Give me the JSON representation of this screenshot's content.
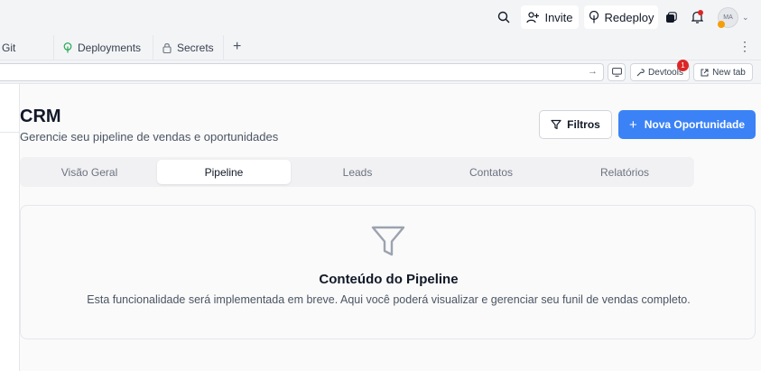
{
  "topbar": {
    "invite_label": "Invite",
    "redeploy_label": "Redeploy",
    "avatar_initials": "MA"
  },
  "tabs": [
    {
      "label": "Git",
      "icon": "git-icon"
    },
    {
      "label": "Deployments",
      "icon": "tree-icon"
    },
    {
      "label": "Secrets",
      "icon": "lock-icon"
    }
  ],
  "addressbar": {
    "url": "",
    "devtools_label": "Devtools",
    "devtools_badge": "1",
    "newtab_label": "New tab"
  },
  "page": {
    "title": "CRM",
    "subtitle": "Gerencie seu pipeline de vendas e oportunidades",
    "filter_label": "Filtros",
    "new_label": "Nova Oportunidade"
  },
  "segments": [
    {
      "label": "Visão Geral",
      "active": false
    },
    {
      "label": "Pipeline",
      "active": true
    },
    {
      "label": "Leads",
      "active": false
    },
    {
      "label": "Contatos",
      "active": false
    },
    {
      "label": "Relatórios",
      "active": false
    }
  ],
  "content": {
    "title": "Conteúdo do Pipeline",
    "description": "Esta funcionalidade será implementada em breve. Aqui você poderá visualizar e gerenciar seu funil de vendas completo."
  },
  "colors": {
    "accent": "#3b82f6",
    "notification": "#dc2626"
  }
}
